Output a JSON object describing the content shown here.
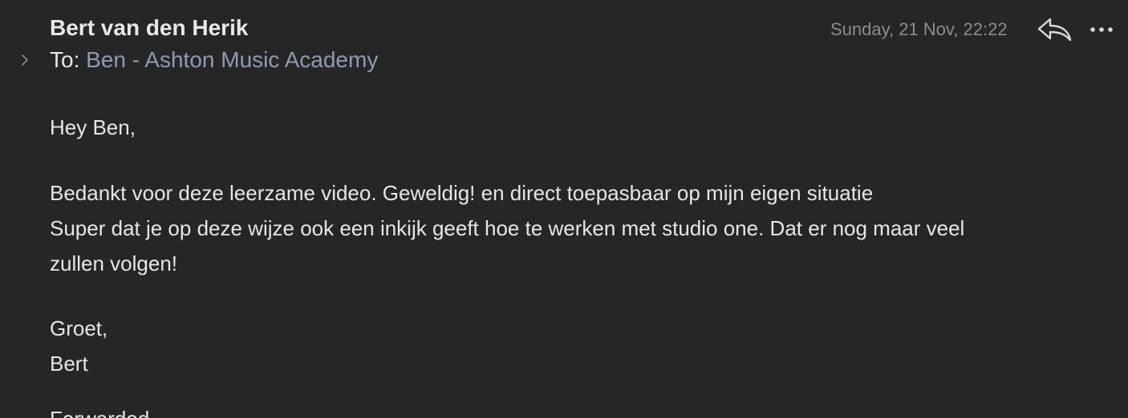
{
  "header": {
    "sender": "Bert van den Herik",
    "to_label": "To:",
    "recipient": "Ben - Ashton Music Academy",
    "date": "Sunday, 21 Nov, 22:22"
  },
  "icons": {
    "expand": "chevron-right-icon",
    "reply": "reply-icon",
    "more": "more-icon"
  },
  "body": {
    "greeting": "Hey Ben,",
    "paragraph_lines": [
      "Bedankt voor deze leerzame video. Geweldig!  en direct toepasbaar op mijn eigen situatie",
      "Super dat je op deze wijze ook een inkijk geeft hoe te werken met studio one. Dat er nog maar veel",
      "zullen volgen!"
    ],
    "closing": "Groet,",
    "signature": "Bert",
    "footer_partial": "Forwarded"
  },
  "colors": {
    "background": "#262626",
    "text": "#e6e6e6",
    "link": "#8e9bb5",
    "muted": "#8c8c8c"
  }
}
